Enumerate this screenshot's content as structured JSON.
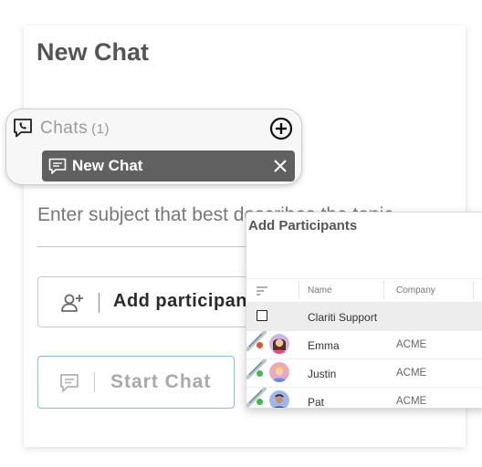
{
  "main": {
    "title": "New Chat",
    "subject_placeholder": "Enter subject that best describes the topic",
    "add_participants_label": "Add participants",
    "start_chat_label": "Start Chat"
  },
  "chats_popup": {
    "title": "Chats",
    "count": "(1)",
    "tab_label": "New Chat"
  },
  "participants_panel": {
    "title": "Add Participants",
    "columns": [
      "Name",
      "Company"
    ],
    "rows": [
      {
        "name": "Clariti Support",
        "company": "",
        "status": ""
      },
      {
        "name": "Emma",
        "company": "ACME",
        "status": "busy"
      },
      {
        "name": "Justin",
        "company": "ACME",
        "status": "online"
      },
      {
        "name": "Pat",
        "company": "ACME",
        "status": "online"
      }
    ]
  },
  "colors": {
    "accent_blue": "#7cc3e2",
    "tab_bg": "#606060",
    "status_busy": "#e5532e",
    "status_online": "#3dba4e"
  }
}
